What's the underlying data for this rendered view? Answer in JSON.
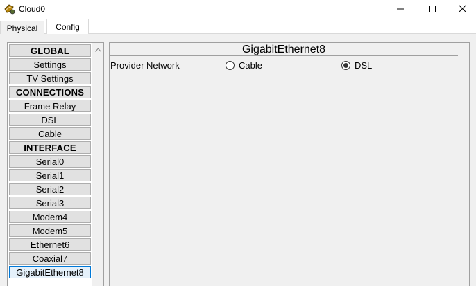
{
  "window": {
    "title": "Cloud0",
    "icon": "cloud-device-icon",
    "controls": {
      "minimize_icon": "minimize-icon",
      "maximize_icon": "maximize-icon",
      "close_icon": "close-icon"
    }
  },
  "tabs": [
    {
      "label": "Physical",
      "active": false
    },
    {
      "label": "Config",
      "active": true
    }
  ],
  "sidebar": {
    "items": [
      {
        "label": "GLOBAL",
        "type": "header"
      },
      {
        "label": "Settings",
        "type": "item"
      },
      {
        "label": "TV Settings",
        "type": "item"
      },
      {
        "label": "CONNECTIONS",
        "type": "header"
      },
      {
        "label": "Frame Relay",
        "type": "item"
      },
      {
        "label": "DSL",
        "type": "item"
      },
      {
        "label": "Cable",
        "type": "item"
      },
      {
        "label": "INTERFACE",
        "type": "header"
      },
      {
        "label": "Serial0",
        "type": "item"
      },
      {
        "label": "Serial1",
        "type": "item"
      },
      {
        "label": "Serial2",
        "type": "item"
      },
      {
        "label": "Serial3",
        "type": "item"
      },
      {
        "label": "Modem4",
        "type": "item"
      },
      {
        "label": "Modem5",
        "type": "item"
      },
      {
        "label": "Ethernet6",
        "type": "item"
      },
      {
        "label": "Coaxial7",
        "type": "item"
      },
      {
        "label": "GigabitEthernet8",
        "type": "item",
        "selected": true
      }
    ],
    "scroll_up_icon": "chevron-up-icon"
  },
  "panel": {
    "title": "GigabitEthernet8",
    "provider_network": {
      "label": "Provider Network",
      "options": [
        {
          "label": "Cable",
          "checked": false
        },
        {
          "label": "DSL",
          "checked": true
        }
      ]
    }
  }
}
